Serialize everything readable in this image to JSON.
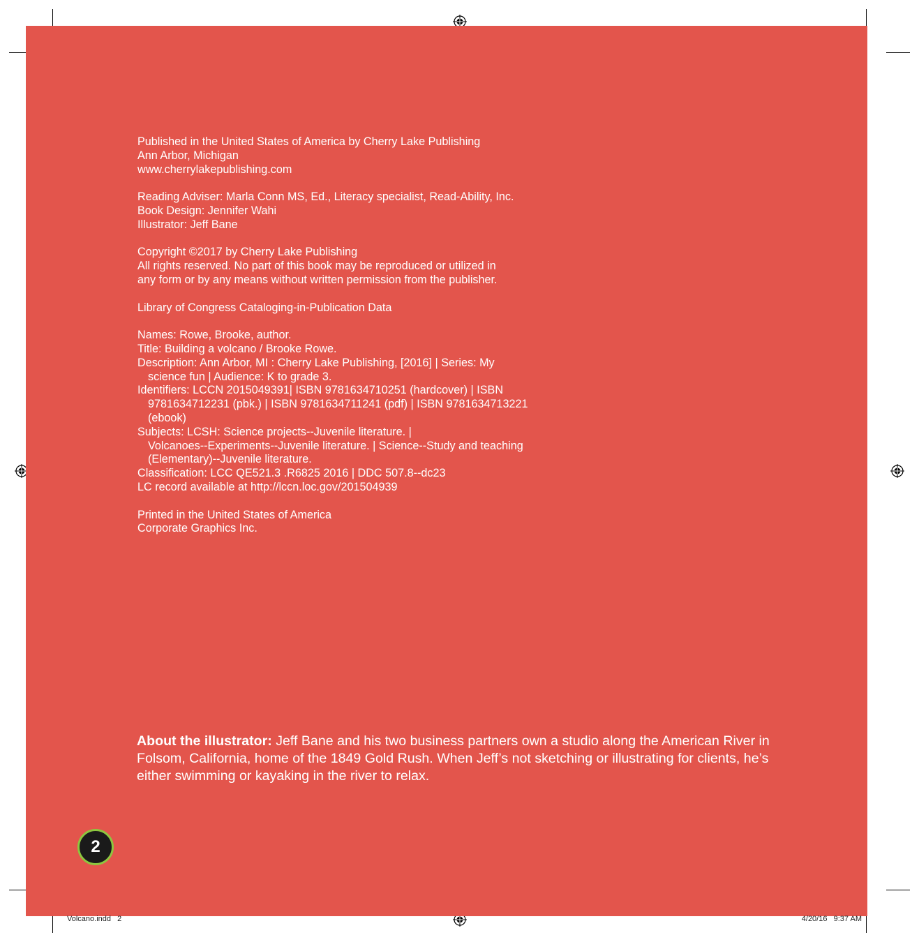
{
  "imprint": {
    "publisher_lines": [
      "Published in the United States of America by Cherry Lake Publishing",
      "Ann Arbor, Michigan",
      "www.cherrylakepublishing.com"
    ],
    "credits_lines": [
      "Reading Adviser: Marla Conn MS, Ed., Literacy specialist, Read-Ability, Inc.",
      "Book Design: Jennifer Wahi",
      "Illustrator: Jeff Bane"
    ],
    "copyright_lines": [
      "Copyright ©2017 by Cherry Lake Publishing",
      "All rights reserved. No part of this book may be reproduced or utilized in",
      "any form or by any means without written permission from the publisher."
    ],
    "cip_heading": "Library of Congress Cataloging-in-Publication Data",
    "cip_lines": [
      "Names: Rowe, Brooke, author.",
      "Title: Building a volcano / Brooke Rowe.",
      "Description: Ann Arbor, MI : Cherry Lake Publishing, [2016] | Series: My",
      "science fun | Audience: K to grade 3.",
      "Identifiers: LCCN 2015049391| ISBN 9781634710251 (hardcover) | ISBN",
      "9781634712231 (pbk.) | ISBN 9781634711241 (pdf) | ISBN 9781634713221",
      "(ebook)",
      "Subjects: LCSH: Science projects--Juvenile literature. |",
      "Volcanoes--Experiments--Juvenile literature. | Science--Study and teaching",
      "(Elementary)--Juvenile literature.",
      "Classification: LCC QE521.3 .R6825 2016 | DDC 507.8--dc23",
      "LC record available at http://lccn.loc.gov/201504939"
    ],
    "printer_lines": [
      "Printed in the United States of America",
      "Corporate Graphics Inc."
    ]
  },
  "about": {
    "lead": "About the illustrator:",
    "body": " Jeff Bane and his two business partners own a studio along the American River in Folsom, California, home of the 1849 Gold Rush. When Jeff’s not sketching or illustrating for clients, he’s either swimming or kayaking in the river to relax."
  },
  "page_number": "2",
  "slug": {
    "file": "Volcano.indd   2",
    "timestamp": "4/20/16   9:37 AM"
  },
  "colors": {
    "page_background": "#e3554c",
    "page_number_ring": "#8cc63f",
    "page_number_fill": "#1a1a1a"
  }
}
